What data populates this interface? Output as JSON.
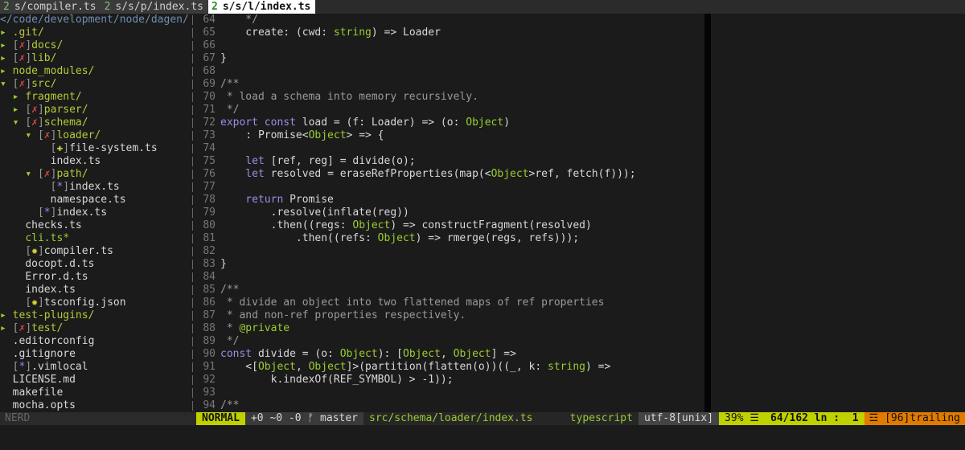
{
  "tabs": [
    {
      "num": "2",
      "label": "s/compiler.ts",
      "active": false
    },
    {
      "num": "2",
      "label": "s/s/p/index.ts",
      "active": false
    },
    {
      "num": "2",
      "label": "s/s/l/index.ts",
      "active": true
    }
  ],
  "tree": {
    "root": "</code/development/node/dagen/",
    "rows": [
      {
        "indent": "",
        "arrow": "▸ ",
        "git": "",
        "name": ".git/",
        "kind": "dir"
      },
      {
        "indent": "",
        "arrow": "▸ ",
        "git": "✗",
        "name": "docs/",
        "kind": "dir"
      },
      {
        "indent": "",
        "arrow": "▸ ",
        "git": "✗",
        "name": "lib/",
        "kind": "dir"
      },
      {
        "indent": "",
        "arrow": "▸ ",
        "git": "",
        "name": "node_modules/",
        "kind": "dir"
      },
      {
        "indent": "",
        "arrow": "▾ ",
        "git": "✗",
        "name": "src/",
        "kind": "dir"
      },
      {
        "indent": "  ",
        "arrow": "▸ ",
        "git": "",
        "name": "fragment/",
        "kind": "dir"
      },
      {
        "indent": "  ",
        "arrow": "▸ ",
        "git": "✗",
        "name": "parser/",
        "kind": "dir"
      },
      {
        "indent": "  ",
        "arrow": "▾ ",
        "git": "✗",
        "name": "schema/",
        "kind": "dir"
      },
      {
        "indent": "    ",
        "arrow": "▾ ",
        "git": "✗",
        "name": "loader/",
        "kind": "dir"
      },
      {
        "indent": "        ",
        "arrow": "",
        "git": "✚",
        "name": "file-system.ts",
        "kind": "file"
      },
      {
        "indent": "        ",
        "arrow": "",
        "git": "",
        "name": "index.ts",
        "kind": "file"
      },
      {
        "indent": "    ",
        "arrow": "▾ ",
        "git": "✗",
        "name": "path/",
        "kind": "dir"
      },
      {
        "indent": "        ",
        "arrow": "",
        "git": "*",
        "name": "index.ts",
        "kind": "file"
      },
      {
        "indent": "        ",
        "arrow": "",
        "git": "",
        "name": "namespace.ts",
        "kind": "file"
      },
      {
        "indent": "      ",
        "arrow": "",
        "git": "*",
        "name": "index.ts",
        "kind": "file"
      },
      {
        "indent": "    ",
        "arrow": "",
        "git": "",
        "name": "checks.ts",
        "kind": "file"
      },
      {
        "indent": "    ",
        "arrow": "",
        "git": "",
        "name": "cli.ts*",
        "kind": "file-mod"
      },
      {
        "indent": "    ",
        "arrow": "",
        "git": "✹",
        "name": "compiler.ts",
        "kind": "file"
      },
      {
        "indent": "    ",
        "arrow": "",
        "git": "",
        "name": "docopt.d.ts",
        "kind": "file"
      },
      {
        "indent": "    ",
        "arrow": "",
        "git": "",
        "name": "Error.d.ts",
        "kind": "file"
      },
      {
        "indent": "    ",
        "arrow": "",
        "git": "",
        "name": "index.ts",
        "kind": "file"
      },
      {
        "indent": "    ",
        "arrow": "",
        "git": "✹",
        "name": "tsconfig.json",
        "kind": "file"
      },
      {
        "indent": "",
        "arrow": "▸ ",
        "git": "",
        "name": "test-plugins/",
        "kind": "dir"
      },
      {
        "indent": "",
        "arrow": "▸ ",
        "git": "✗",
        "name": "test/",
        "kind": "dir"
      },
      {
        "indent": "  ",
        "arrow": "",
        "git": "",
        "name": ".editorconfig",
        "kind": "file"
      },
      {
        "indent": "  ",
        "arrow": "",
        "git": "",
        "name": ".gitignore",
        "kind": "file"
      },
      {
        "indent": "  ",
        "arrow": "",
        "git": "*",
        "name": ".vimlocal",
        "kind": "file"
      },
      {
        "indent": "  ",
        "arrow": "",
        "git": "",
        "name": "LICENSE.md",
        "kind": "file"
      },
      {
        "indent": "  ",
        "arrow": "",
        "git": "",
        "name": "makefile",
        "kind": "file"
      },
      {
        "indent": "  ",
        "arrow": "",
        "git": "",
        "name": "mocha.opts",
        "kind": "file"
      }
    ]
  },
  "code": [
    {
      "n": "64",
      "t": [
        [
          "cm",
          "    */"
        ]
      ]
    },
    {
      "n": "65",
      "t": [
        [
          "pun",
          "    create: ("
        ],
        [
          "pun",
          "cwd: "
        ],
        [
          "ty",
          "string"
        ],
        [
          "pun",
          ") => Loader"
        ]
      ]
    },
    {
      "n": "66",
      "t": []
    },
    {
      "n": "67",
      "t": [
        [
          "pun",
          "}"
        ]
      ]
    },
    {
      "n": "68",
      "t": []
    },
    {
      "n": "69",
      "t": [
        [
          "cm",
          "/**"
        ]
      ]
    },
    {
      "n": "70",
      "t": [
        [
          "cm",
          " * load a schema into memory recursively."
        ]
      ]
    },
    {
      "n": "71",
      "t": [
        [
          "cm",
          " */"
        ]
      ]
    },
    {
      "n": "72",
      "t": [
        [
          "kw",
          "export const "
        ],
        [
          "pun",
          "load = (f: Loader) => (o: "
        ],
        [
          "ty",
          "Object"
        ],
        [
          "pun",
          ")"
        ]
      ]
    },
    {
      "n": "73",
      "t": [
        [
          "pun",
          "    : Promise<"
        ],
        [
          "ty",
          "Object"
        ],
        [
          "pun",
          "> => {"
        ]
      ]
    },
    {
      "n": "74",
      "t": []
    },
    {
      "n": "75",
      "t": [
        [
          "kw",
          "    let "
        ],
        [
          "pun",
          "[ref, reg] = divide(o);"
        ]
      ]
    },
    {
      "n": "76",
      "t": [
        [
          "kw",
          "    let "
        ],
        [
          "pun",
          "resolved = eraseRefProperties(map(<"
        ],
        [
          "ty",
          "Object"
        ],
        [
          "pun",
          ">ref, fetch(f)));"
        ]
      ]
    },
    {
      "n": "77",
      "t": []
    },
    {
      "n": "78",
      "t": [
        [
          "kw",
          "    return "
        ],
        [
          "pun",
          "Promise"
        ]
      ]
    },
    {
      "n": "79",
      "t": [
        [
          "pun",
          "        .resolve(inflate(reg))"
        ]
      ]
    },
    {
      "n": "80",
      "t": [
        [
          "pun",
          "        .then((regs: "
        ],
        [
          "ty",
          "Object"
        ],
        [
          "pun",
          ") => constructFragment(resolved)"
        ]
      ]
    },
    {
      "n": "81",
      "t": [
        [
          "pun",
          "            .then((refs: "
        ],
        [
          "ty",
          "Object"
        ],
        [
          "pun",
          ") => rmerge(regs, refs)));"
        ]
      ]
    },
    {
      "n": "82",
      "t": []
    },
    {
      "n": "83",
      "t": [
        [
          "pun",
          "}"
        ]
      ]
    },
    {
      "n": "84",
      "t": []
    },
    {
      "n": "85",
      "t": [
        [
          "cm",
          "/**"
        ]
      ]
    },
    {
      "n": "86",
      "t": [
        [
          "cm",
          " * divide an object into two flattened maps of ref properties"
        ]
      ]
    },
    {
      "n": "87",
      "t": [
        [
          "cm",
          " * and non-ref properties respectively."
        ]
      ]
    },
    {
      "n": "88",
      "t": [
        [
          "cm",
          " * "
        ],
        [
          "ann",
          "@private"
        ]
      ]
    },
    {
      "n": "89",
      "t": [
        [
          "cm",
          " */"
        ]
      ]
    },
    {
      "n": "90",
      "t": [
        [
          "kw",
          "const "
        ],
        [
          "pun",
          "divide = (o: "
        ],
        [
          "ty",
          "Object"
        ],
        [
          "pun",
          "): ["
        ],
        [
          "ty",
          "Object"
        ],
        [
          "pun",
          ", "
        ],
        [
          "ty",
          "Object"
        ],
        [
          "pun",
          "] =>"
        ]
      ]
    },
    {
      "n": "91",
      "t": [
        [
          "pun",
          "    <["
        ],
        [
          "ty",
          "Object"
        ],
        [
          "pun",
          ", "
        ],
        [
          "ty",
          "Object"
        ],
        [
          "pun",
          "]>(partition(flatten(o))((_, k: "
        ],
        [
          "ty",
          "string"
        ],
        [
          "pun",
          ") =>"
        ]
      ]
    },
    {
      "n": "92",
      "t": [
        [
          "pun",
          "        k.indexOf(REF_SYMBOL) > -1));"
        ]
      ]
    },
    {
      "n": "93",
      "t": []
    },
    {
      "n": "94",
      "t": [
        [
          "cm",
          "/**"
        ]
      ]
    }
  ],
  "status": {
    "tree_label": "NERD",
    "mode": "NORMAL",
    "git": "+0 ~0 -0 ᚠ master",
    "file": "src/schema/loader/index.ts",
    "filetype": "typescript",
    "encoding": "utf-8[unix]",
    "percent": "39% ☰",
    "position": "64/162 ln :  1",
    "warning": "☲ [96]trailing"
  }
}
